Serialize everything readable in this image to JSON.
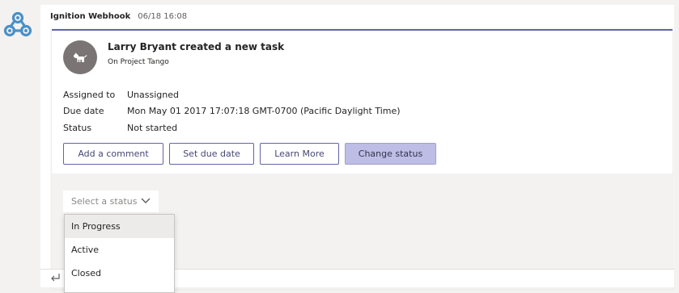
{
  "message": {
    "sender": "Ignition Webhook",
    "time": "06/18 16:08"
  },
  "card": {
    "title": "Larry Bryant created a new task",
    "subtitle": "On Project Tango",
    "facts": [
      {
        "key": "Assigned to",
        "value": "Unassigned"
      },
      {
        "key": "Due date",
        "value": "Mon May 01 2017 17:07:18 GMT-0700 (Pacific Daylight Time)"
      },
      {
        "key": "Status",
        "value": "Not started"
      }
    ],
    "actions": [
      {
        "label": "Add a comment"
      },
      {
        "label": "Set due date"
      },
      {
        "label": "Learn More"
      },
      {
        "label": "Change status"
      }
    ]
  },
  "status_select": {
    "placeholder": "Select a status",
    "options": [
      "In Progress",
      "Active",
      "Closed"
    ]
  },
  "colors": {
    "accent": "#6264a7",
    "active_button": "#bdbde6"
  },
  "icons": [
    "webhook-bot-icon",
    "dog-avatar-icon",
    "chevron-down-icon",
    "reply-icon"
  ]
}
